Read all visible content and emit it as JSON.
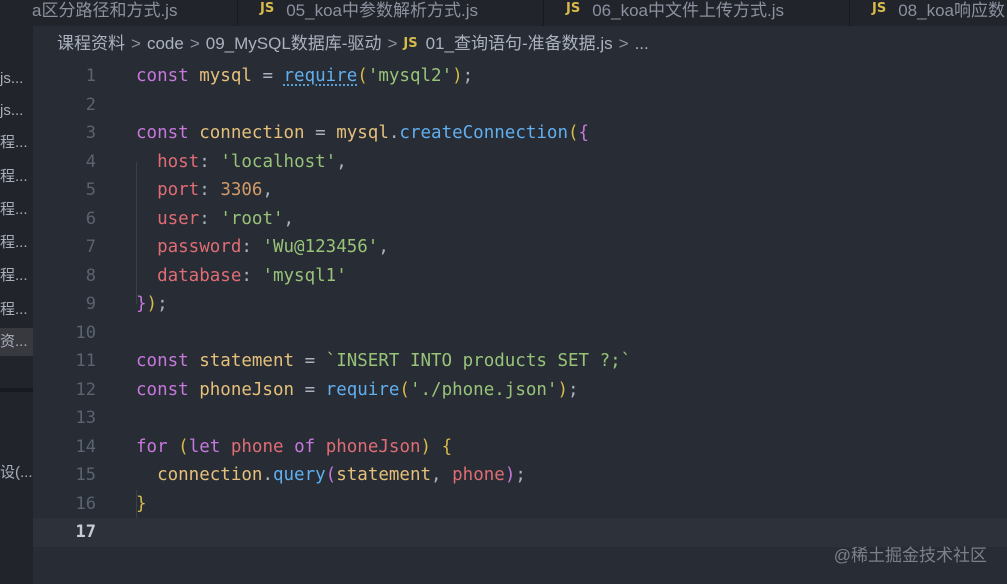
{
  "tabs": [
    {
      "label": "a区分路径和方式.js",
      "has_js": false
    },
    {
      "label": "05_koa中参数解析方式.js",
      "has_js": true
    },
    {
      "label": "06_koa中文件上传方式.js",
      "has_js": true
    },
    {
      "label": "08_koa响应数",
      "has_js": true
    }
  ],
  "js_badge": "JS",
  "sidebar": {
    "items": [
      "js...",
      "js...",
      "程...",
      "程...",
      "程...",
      "程...",
      "程...",
      "程...",
      "资..."
    ],
    "bottom_item": "设(..."
  },
  "breadcrumb": {
    "items": [
      "课程资料",
      "code",
      "09_MySQL数据库-驱动"
    ],
    "file": "01_查询语句-准备数据.js",
    "more": "...",
    "separator": ">"
  },
  "editor": {
    "current_line": 17,
    "lines": [
      {
        "n": "1",
        "tokens": [
          [
            "kw",
            "const "
          ],
          [
            "var",
            "mysql"
          ],
          [
            "pu",
            " = "
          ],
          [
            "req",
            "require"
          ],
          [
            "b1",
            "("
          ],
          [
            "str",
            "'mysql2'"
          ],
          [
            "b1",
            ")"
          ],
          [
            "pu",
            ";"
          ]
        ]
      },
      {
        "n": "2",
        "tokens": []
      },
      {
        "n": "3",
        "tokens": [
          [
            "kw",
            "const "
          ],
          [
            "var",
            "connection"
          ],
          [
            "pu",
            " = "
          ],
          [
            "var",
            "mysql"
          ],
          [
            "pu",
            "."
          ],
          [
            "fn",
            "createConnection"
          ],
          [
            "b1",
            "("
          ],
          [
            "b2",
            "{"
          ]
        ]
      },
      {
        "n": "4",
        "tokens": [
          [
            "pu",
            "  "
          ],
          [
            "prop",
            "host"
          ],
          [
            "pu",
            ": "
          ],
          [
            "str",
            "'localhost'"
          ],
          [
            "pu",
            ","
          ]
        ]
      },
      {
        "n": "5",
        "tokens": [
          [
            "pu",
            "  "
          ],
          [
            "prop",
            "port"
          ],
          [
            "pu",
            ": "
          ],
          [
            "num",
            "3306"
          ],
          [
            "pu",
            ","
          ]
        ]
      },
      {
        "n": "6",
        "tokens": [
          [
            "pu",
            "  "
          ],
          [
            "prop",
            "user"
          ],
          [
            "pu",
            ": "
          ],
          [
            "str",
            "'root'"
          ],
          [
            "pu",
            ","
          ]
        ]
      },
      {
        "n": "7",
        "tokens": [
          [
            "pu",
            "  "
          ],
          [
            "prop",
            "password"
          ],
          [
            "pu",
            ": "
          ],
          [
            "str",
            "'Wu@123456'"
          ],
          [
            "pu",
            ","
          ]
        ]
      },
      {
        "n": "8",
        "tokens": [
          [
            "pu",
            "  "
          ],
          [
            "prop",
            "database"
          ],
          [
            "pu",
            ": "
          ],
          [
            "str",
            "'mysql1'"
          ]
        ]
      },
      {
        "n": "9",
        "tokens": [
          [
            "b2",
            "}"
          ],
          [
            "b1",
            ")"
          ],
          [
            "pu",
            ";"
          ]
        ]
      },
      {
        "n": "10",
        "tokens": []
      },
      {
        "n": "11",
        "tokens": [
          [
            "kw",
            "const "
          ],
          [
            "var",
            "statement"
          ],
          [
            "pu",
            " = "
          ],
          [
            "str",
            "`INSERT INTO products SET ?;`"
          ]
        ]
      },
      {
        "n": "12",
        "tokens": [
          [
            "kw",
            "const "
          ],
          [
            "var",
            "phoneJson"
          ],
          [
            "pu",
            " = "
          ],
          [
            "fn",
            "require"
          ],
          [
            "b1",
            "("
          ],
          [
            "str",
            "'./phone.json'"
          ],
          [
            "b1",
            ")"
          ],
          [
            "pu",
            ";"
          ]
        ]
      },
      {
        "n": "13",
        "tokens": []
      },
      {
        "n": "14",
        "tokens": [
          [
            "kw",
            "for "
          ],
          [
            "b1",
            "("
          ],
          [
            "kw",
            "let "
          ],
          [
            "prop",
            "phone "
          ],
          [
            "kw",
            "of "
          ],
          [
            "prop",
            "phoneJson"
          ],
          [
            "b1",
            ")"
          ],
          [
            "pu",
            " "
          ],
          [
            "b1",
            "{"
          ]
        ]
      },
      {
        "n": "15",
        "tokens": [
          [
            "pu",
            "  "
          ],
          [
            "var",
            "connection"
          ],
          [
            "pu",
            "."
          ],
          [
            "fn",
            "query"
          ],
          [
            "b2",
            "("
          ],
          [
            "var",
            "statement"
          ],
          [
            "pu",
            ", "
          ],
          [
            "prop",
            "phone"
          ],
          [
            "b2",
            ")"
          ],
          [
            "pu",
            ";"
          ]
        ]
      },
      {
        "n": "16",
        "tokens": [
          [
            "b1",
            "}"
          ]
        ]
      },
      {
        "n": "17",
        "tokens": []
      }
    ]
  },
  "colors": {
    "background": "#282c34",
    "keyword": "#c678dd",
    "string": "#98c379",
    "variable": "#e5c07b",
    "property": "#e06c75",
    "number": "#d19a66",
    "function": "#61afef",
    "bracket": "#d7ba4a"
  },
  "watermark": "@稀土掘金技术社区"
}
